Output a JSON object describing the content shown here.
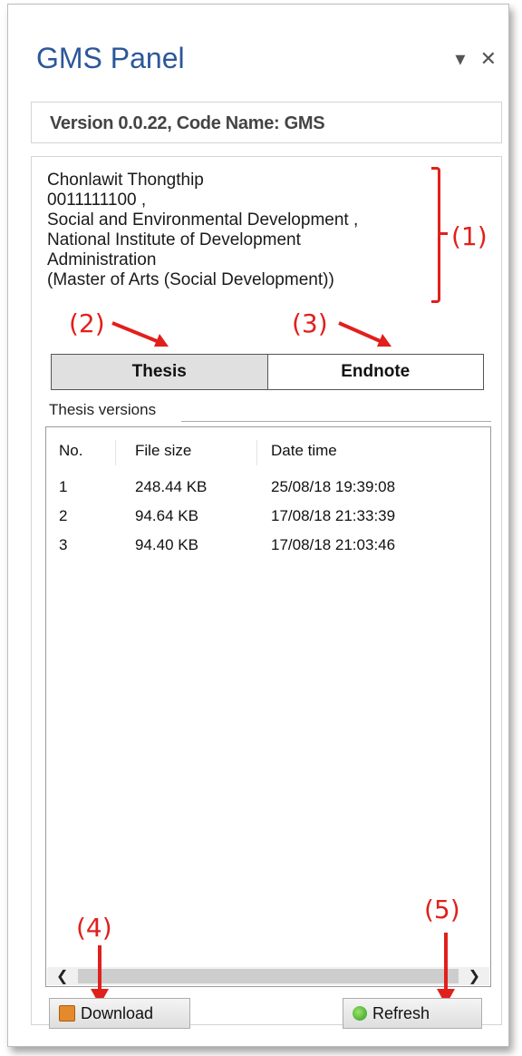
{
  "panel": {
    "title": "GMS Panel",
    "dropdown_glyph": "▾",
    "close_glyph": "✕"
  },
  "version_text": "Version 0.0.22, Code Name: GMS",
  "user_info": {
    "name": "Chonlawit Thongthip",
    "id": "0011111100 ,",
    "department": "Social and Environmental Development ,",
    "institute_line1": "National Institute of Development",
    "institute_line2": "Administration",
    "degree": "(Master of Arts (Social Development))"
  },
  "tabs": [
    {
      "label": "Thesis",
      "active": true
    },
    {
      "label": "Endnote",
      "active": false
    }
  ],
  "thesis_versions": {
    "label": "Thesis versions",
    "columns": [
      "No.",
      "File size",
      "Date time"
    ],
    "rows": [
      {
        "no": "1",
        "size": "248.44 KB",
        "datetime": "25/08/18 19:39:08"
      },
      {
        "no": "2",
        "size": "94.64 KB",
        "datetime": "17/08/18 21:33:39"
      },
      {
        "no": "3",
        "size": "94.40 KB",
        "datetime": "17/08/18 21:03:46"
      }
    ]
  },
  "buttons": {
    "download": "Download",
    "refresh": "Refresh"
  },
  "annotations": {
    "a1": "(1)",
    "a2": "(2)",
    "a3": "(3)",
    "a4": "(4)",
    "a5": "(5)"
  },
  "colors": {
    "title_blue": "#2b579a",
    "annotation_red": "#e0201c",
    "download_icon": "#e48a2a",
    "refresh_icon": "#2e9a20"
  }
}
